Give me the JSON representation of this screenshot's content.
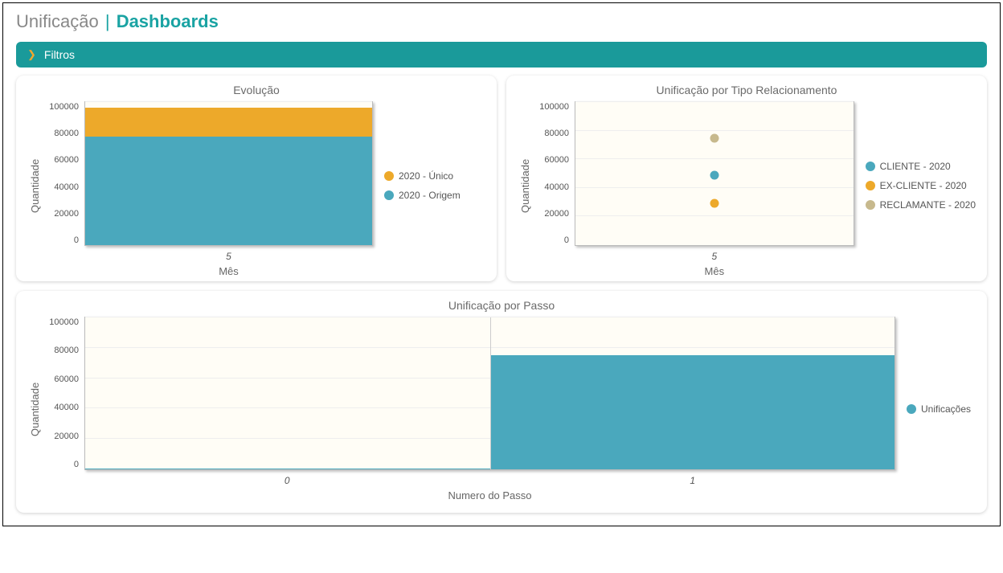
{
  "header": {
    "prefix": "Unificação",
    "separator": "|",
    "page": "Dashboards"
  },
  "filters": {
    "label": "Filtros"
  },
  "colors": {
    "teal": "#4aa8bd",
    "orange": "#eda92a",
    "tan": "#c7b98d"
  },
  "chart_data": [
    {
      "id": "evolucao",
      "type": "bar",
      "stacked": true,
      "title": "Evolução",
      "xlabel": "Mês",
      "ylabel": "Quantidade",
      "ylim": [
        0,
        100000
      ],
      "yticks": [
        0,
        20000,
        40000,
        60000,
        80000,
        100000
      ],
      "categories": [
        "5"
      ],
      "series": [
        {
          "name": "2020 - Único",
          "color": "#eda92a",
          "values": [
            96000
          ]
        },
        {
          "name": "2020 - Origem",
          "color": "#4aa8bd",
          "values": [
            76000
          ]
        }
      ]
    },
    {
      "id": "tipo",
      "type": "scatter",
      "title": "Unificação por Tipo Relacionamento",
      "xlabel": "Mês",
      "ylabel": "Quantidade",
      "ylim": [
        0,
        100000
      ],
      "yticks": [
        0,
        20000,
        40000,
        60000,
        80000,
        100000
      ],
      "categories": [
        "5"
      ],
      "series": [
        {
          "name": "CLIENTE - 2020",
          "color": "#4aa8bd",
          "values": [
            49000
          ]
        },
        {
          "name": "EX-CLIENTE - 2020",
          "color": "#eda92a",
          "values": [
            29000
          ]
        },
        {
          "name": "RECLAMANTE - 2020",
          "color": "#c7b98d",
          "values": [
            75000
          ]
        }
      ]
    },
    {
      "id": "passo",
      "type": "bar",
      "title": "Unificação por Passo",
      "xlabel": "Numero do Passo",
      "ylabel": "Quantidade",
      "ylim": [
        0,
        100000
      ],
      "yticks": [
        0,
        20000,
        40000,
        60000,
        80000,
        100000
      ],
      "categories": [
        "0",
        "1"
      ],
      "series": [
        {
          "name": "Unificações",
          "color": "#4aa8bd",
          "values": [
            500,
            75000
          ]
        }
      ]
    }
  ]
}
